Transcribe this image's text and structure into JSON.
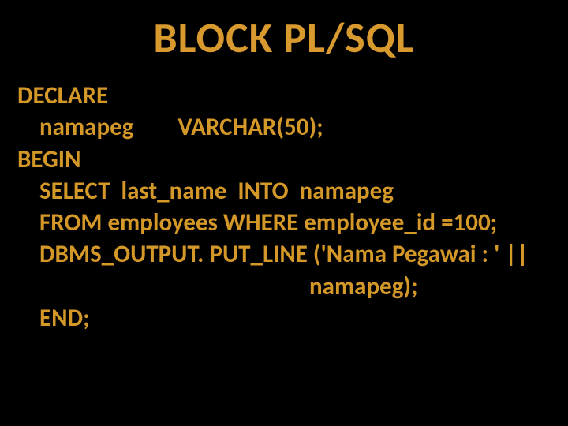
{
  "title": "BLOCK  PL/SQL",
  "code": {
    "line1": "DECLARE",
    "line2": "namapeg        VARCHAR(50);",
    "line3": "BEGIN",
    "line4": "SELECT  last_name  INTO  namapeg",
    "line5": "FROM employees WHERE employee_id =100;",
    "line6": "DBMS_OUTPUT. PUT_LINE ('Nama Pegawai : ' ||",
    "line7": "namapeg);",
    "line8": "END;",
    "line9": "/"
  }
}
